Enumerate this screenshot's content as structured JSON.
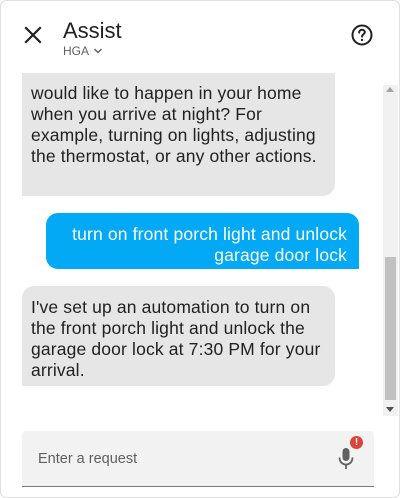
{
  "header": {
    "title": "Assist",
    "pipeline": "HGA",
    "close_icon": "close-icon",
    "help_icon": "help-circle-icon"
  },
  "messages": [
    {
      "from": "hass",
      "text": "would like to happen in your home when you arrive at night? For example, turning on lights, adjusting the thermostat, or any other actions."
    },
    {
      "from": "user",
      "text": "turn on front porch light and unlock garage door lock"
    },
    {
      "from": "hass",
      "text": "I've set up an automation to turn on the front porch light and unlock the garage door lock at 7:30 PM for your arrival."
    }
  ],
  "input": {
    "placeholder": "Enter a request",
    "value": ""
  },
  "mic": {
    "icon": "microphone-icon",
    "badge": "!"
  },
  "colors": {
    "user_bubble": "#03a9f4",
    "hass_bubble": "#e6e6e6",
    "badge": "#db4437"
  }
}
